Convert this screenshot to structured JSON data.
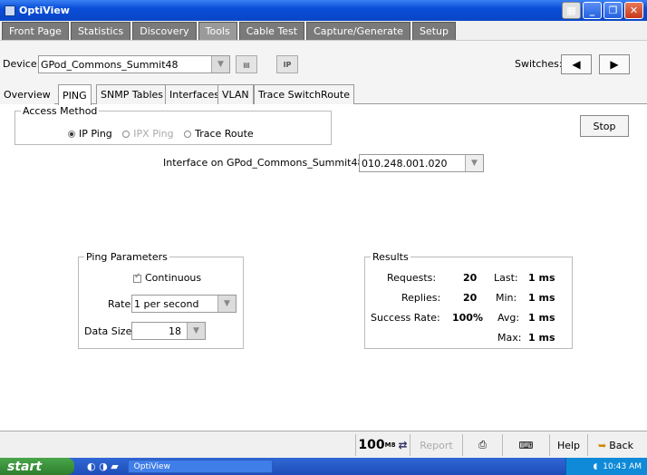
{
  "window": {
    "title": "OptiView"
  },
  "menu": {
    "tabs": [
      "Front Page",
      "Statistics",
      "Discovery",
      "Tools",
      "Cable Test",
      "Capture/Generate",
      "Setup"
    ]
  },
  "device": {
    "label": "Device:",
    "value": "GPod_Commons_Summit48",
    "ip_label": "IP",
    "switches_label": "Switches:"
  },
  "subtabs": [
    "Overview",
    "PING",
    "SNMP Tables",
    "Interfaces",
    "VLAN",
    "Trace SwitchRoute"
  ],
  "access": {
    "title": "Access Method",
    "options": [
      "IP Ping",
      "IPX Ping",
      "Trace Route"
    ],
    "selected": "IP Ping"
  },
  "stop_label": "Stop",
  "interface": {
    "label": "Interface on GPod_Commons_Summit48:",
    "value": "010.248.001.020"
  },
  "ping_params": {
    "title": "Ping Parameters",
    "continuous_label": "Continuous",
    "continuous": true,
    "rate_label": "Rate:",
    "rate_value": "1 per second",
    "size_label": "Data Size:",
    "size_value": "18"
  },
  "results": {
    "title": "Results",
    "requests_label": "Requests:",
    "requests": "20",
    "replies_label": "Replies:",
    "replies": "20",
    "success_label": "Success Rate:",
    "success": "100%",
    "last_label": "Last:",
    "last": "1 ms",
    "min_label": "Min:",
    "min": "1 ms",
    "avg_label": "Avg:",
    "avg": "1 ms",
    "max_label": "Max:",
    "max": "1 ms"
  },
  "statusbar": {
    "speed": "100",
    "speed_unit": "M8",
    "report": "Report",
    "help": "Help",
    "back": "Back"
  },
  "taskbar": {
    "start": "start",
    "item": "OptiView",
    "time": "10:43 AM"
  }
}
